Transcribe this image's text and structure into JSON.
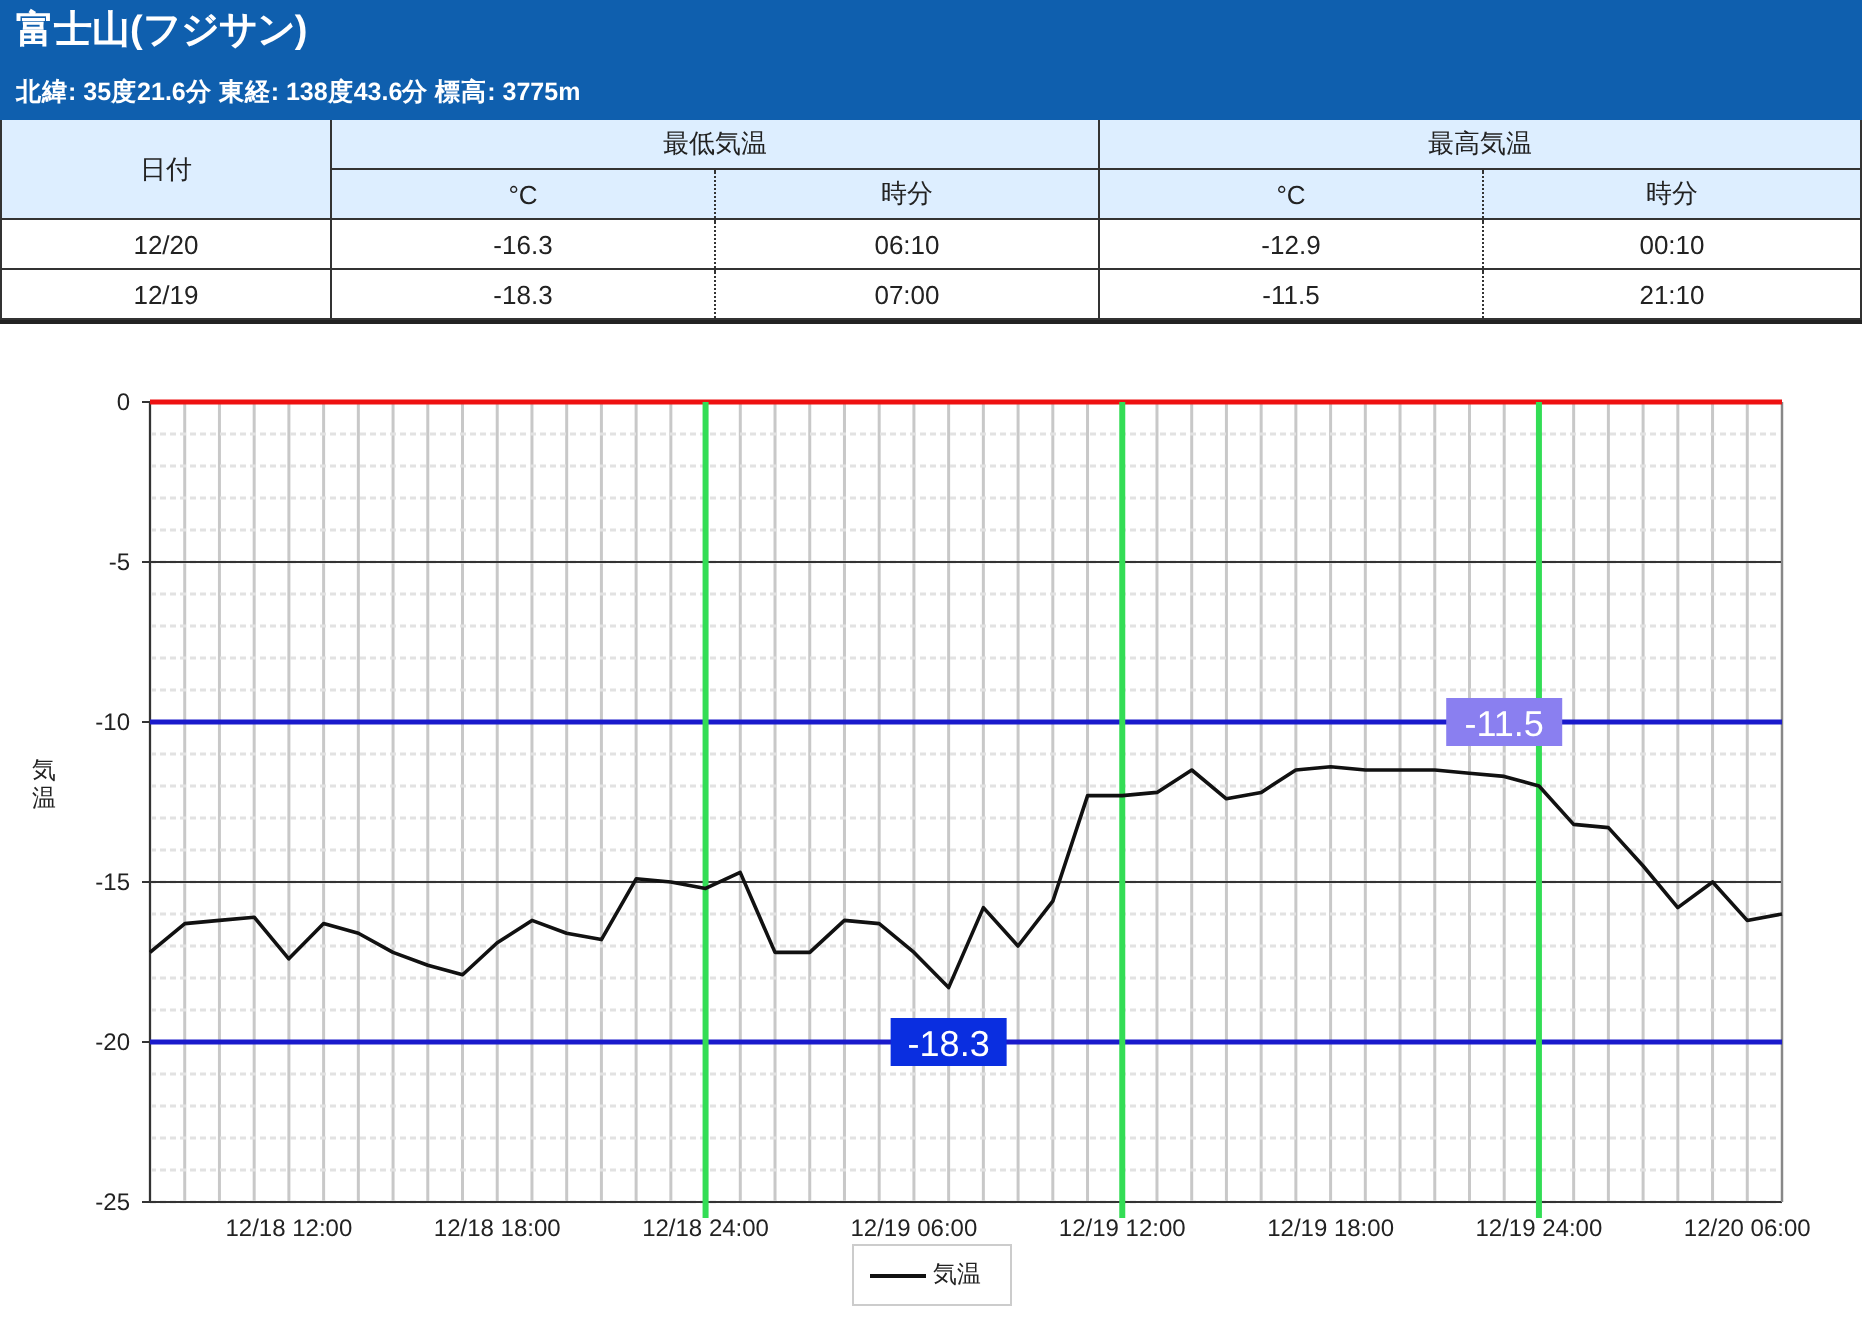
{
  "header": {
    "title": "富士山(フジサン)",
    "subtitle": "北緯: 35度21.6分 東経: 138度43.6分 標高: 3775m"
  },
  "table": {
    "date_column": "日付",
    "groups": [
      {
        "label": "最低気温",
        "columns": [
          "°C",
          "時分"
        ]
      },
      {
        "label": "最高気温",
        "columns": [
          "°C",
          "時分"
        ]
      }
    ],
    "rows": [
      [
        "12/20",
        "-16.3",
        "06:10",
        "-12.9",
        "00:10"
      ],
      [
        "12/19",
        "-18.3",
        "07:00",
        "-11.5",
        "21:10"
      ]
    ]
  },
  "chart": {
    "chart_data": {
      "type": "line",
      "ylabel": "気温",
      "categories": [
        null,
        null,
        null,
        null,
        "12/18 12:00",
        null,
        null,
        null,
        null,
        null,
        "12/18 18:00",
        null,
        null,
        null,
        null,
        null,
        "12/18 24:00",
        null,
        null,
        null,
        null,
        null,
        "12/19 06:00",
        null,
        null,
        null,
        null,
        null,
        "12/19 12:00",
        null,
        null,
        null,
        null,
        null,
        "12/19 18:00",
        null,
        null,
        null,
        null,
        null,
        "12/19 24:00",
        null,
        null,
        null,
        null,
        null,
        "12/20 06:00",
        null
      ],
      "series": [
        {
          "name": "気温",
          "color": "#111111",
          "values": [
            -17.2,
            -16.3,
            -16.2,
            -16.1,
            -17.4,
            -16.3,
            -16.6,
            -17.2,
            -17.6,
            -17.9,
            -16.9,
            -16.2,
            -16.6,
            -16.8,
            -14.9,
            -15.0,
            -15.2,
            -14.7,
            -17.2,
            -17.2,
            -16.2,
            -16.3,
            -17.2,
            -18.3,
            -15.8,
            -17.0,
            -15.6,
            -12.3,
            -12.3,
            -12.2,
            -11.5,
            -12.4,
            -12.2,
            -11.5,
            -11.4,
            -11.5,
            -11.5,
            -11.5,
            -11.6,
            -11.7,
            -12.0,
            -13.2,
            -13.3,
            -14.5,
            -15.8,
            -15.0,
            -16.2,
            -16.0
          ]
        }
      ],
      "ylim": [
        -25,
        0
      ],
      "grid": true,
      "yticks": [
        0,
        -5,
        -10,
        -15,
        -20,
        -25
      ],
      "annotations": [
        "-18.3",
        "-11.5"
      ]
    }
  }
}
